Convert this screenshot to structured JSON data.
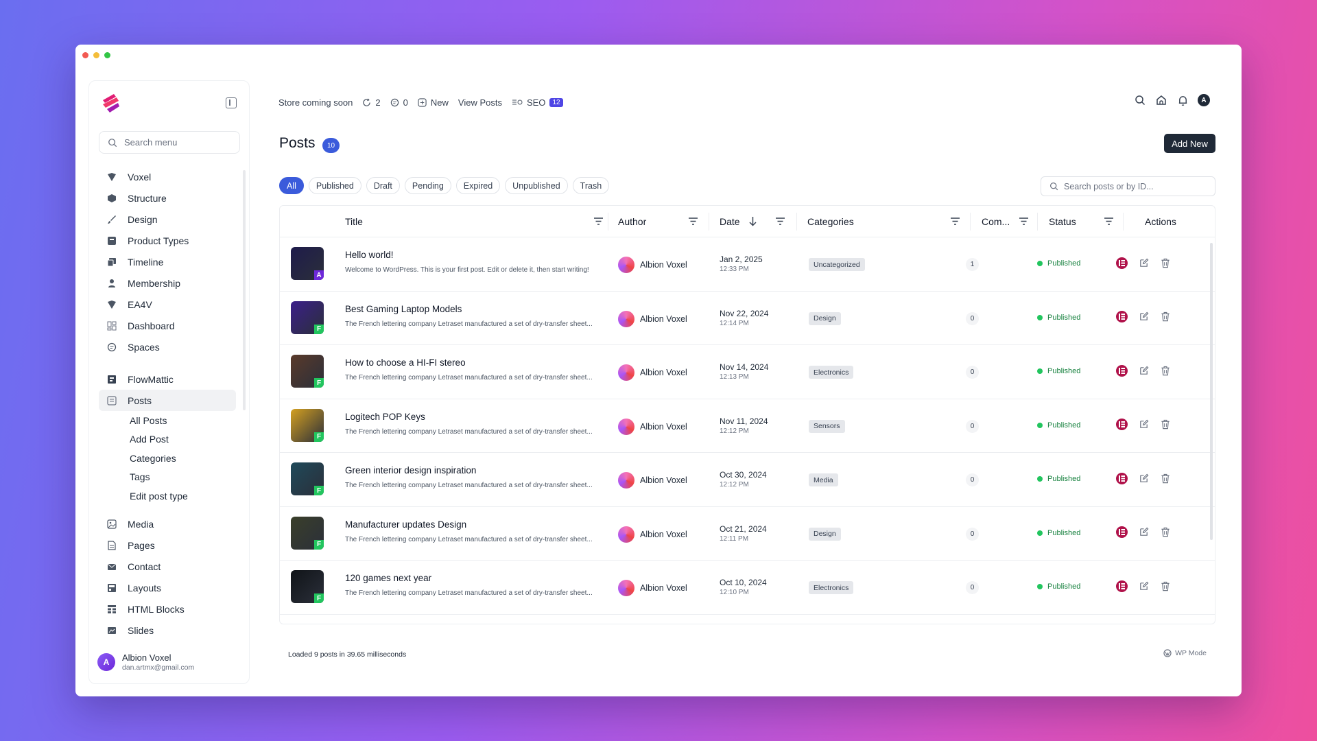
{
  "sidebar": {
    "search_placeholder": "Search menu",
    "items": [
      {
        "label": "Voxel",
        "icon": "voxel-icon"
      },
      {
        "label": "Structure",
        "icon": "cube-icon"
      },
      {
        "label": "Design",
        "icon": "brush-icon"
      },
      {
        "label": "Product Types",
        "icon": "box-icon"
      },
      {
        "label": "Timeline",
        "icon": "timeline-icon"
      },
      {
        "label": "Membership",
        "icon": "user-icon"
      },
      {
        "label": "EA4V",
        "icon": "voxel-icon"
      },
      {
        "label": "Dashboard",
        "icon": "dashboard-icon"
      },
      {
        "label": "Spaces",
        "icon": "chat-icon"
      }
    ],
    "items2": [
      {
        "label": "FlowMattic",
        "icon": "flowmattic-icon"
      },
      {
        "label": "Posts",
        "icon": "posts-icon"
      }
    ],
    "subitems": [
      "All Posts",
      "Add Post",
      "Categories",
      "Tags",
      "Edit post type"
    ],
    "items3": [
      {
        "label": "Media",
        "icon": "media-icon"
      },
      {
        "label": "Pages",
        "icon": "page-icon"
      },
      {
        "label": "Contact",
        "icon": "mail-icon"
      },
      {
        "label": "Layouts",
        "icon": "layout-icon"
      },
      {
        "label": "HTML Blocks",
        "icon": "grid-icon"
      },
      {
        "label": "Slides",
        "icon": "slides-icon"
      }
    ],
    "user": {
      "name": "Albion Voxel",
      "email": "dan.artmx@gmail.com",
      "initial": "A"
    }
  },
  "topbar": {
    "store": "Store coming soon",
    "updates": "2",
    "comments": "0",
    "new": "New",
    "view_posts": "View Posts",
    "seo": "SEO",
    "seo_count": "12",
    "avatar_initial": "A"
  },
  "page": {
    "title": "Posts",
    "count": "10",
    "add_new": "Add New",
    "search_placeholder": "Search posts or by ID..."
  },
  "filters": [
    "All",
    "Published",
    "Draft",
    "Pending",
    "Expired",
    "Unpublished",
    "Trash"
  ],
  "columns": {
    "title": "Title",
    "author": "Author",
    "date": "Date",
    "categories": "Categories",
    "comments": "Com...",
    "status": "Status",
    "actions": "Actions"
  },
  "rows": [
    {
      "title": "Hello world!",
      "excerpt": "Welcome to WordPress. This is your first post. Edit or delete it, then start writing!",
      "author": "Albion Voxel",
      "date": "Jan 2, 2025",
      "time": "12:33 PM",
      "category": "Uncategorized",
      "comments": "1",
      "status": "Published",
      "badge": "A",
      "badge_color": "#6d28d9",
      "thumb_color": "#1e1b4b"
    },
    {
      "title": "Best Gaming Laptop Models",
      "excerpt": "The French lettering company Letraset manufactured a set of dry-transfer sheet...",
      "author": "Albion Voxel",
      "date": "Nov 22, 2024",
      "time": "12:14 PM",
      "category": "Design",
      "comments": "0",
      "status": "Published",
      "badge": "F",
      "badge_color": "#22c55e",
      "thumb_color": "#3b1f8a"
    },
    {
      "title": "How to choose a HI-FI stereo",
      "excerpt": "The French lettering company Letraset manufactured a set of dry-transfer sheet...",
      "author": "Albion Voxel",
      "date": "Nov 14, 2024",
      "time": "12:13 PM",
      "category": "Electronics",
      "comments": "0",
      "status": "Published",
      "badge": "F",
      "badge_color": "#22c55e",
      "thumb_color": "#5a3a2a"
    },
    {
      "title": "Logitech POP Keys",
      "excerpt": "The French lettering company Letraset manufactured a set of dry-transfer sheet...",
      "author": "Albion Voxel",
      "date": "Nov 11, 2024",
      "time": "12:12 PM",
      "category": "Sensors",
      "comments": "0",
      "status": "Published",
      "badge": "F",
      "badge_color": "#22c55e",
      "thumb_color": "#d4a020"
    },
    {
      "title": "Green interior design inspiration",
      "excerpt": "The French lettering company Letraset manufactured a set of dry-transfer sheet...",
      "author": "Albion Voxel",
      "date": "Oct 30, 2024",
      "time": "12:12 PM",
      "category": "Media",
      "comments": "0",
      "status": "Published",
      "badge": "F",
      "badge_color": "#22c55e",
      "thumb_color": "#1f4a5a"
    },
    {
      "title": "Manufacturer updates Design",
      "excerpt": "The French lettering company Letraset manufactured a set of dry-transfer sheet...",
      "author": "Albion Voxel",
      "date": "Oct 21, 2024",
      "time": "12:11 PM",
      "category": "Design",
      "comments": "0",
      "status": "Published",
      "badge": "F",
      "badge_color": "#22c55e",
      "thumb_color": "#3a3f2a"
    },
    {
      "title": "120 games next year",
      "excerpt": "The French lettering company Letraset manufactured a set of dry-transfer sheet...",
      "author": "Albion Voxel",
      "date": "Oct 10, 2024",
      "time": "12:10 PM",
      "category": "Electronics",
      "comments": "0",
      "status": "Published",
      "badge": "F",
      "badge_color": "#22c55e",
      "thumb_color": "#101418"
    }
  ],
  "footer": {
    "loaded": "Loaded 9 posts in 39.65 milliseconds",
    "wp_mode": "WP Mode"
  }
}
